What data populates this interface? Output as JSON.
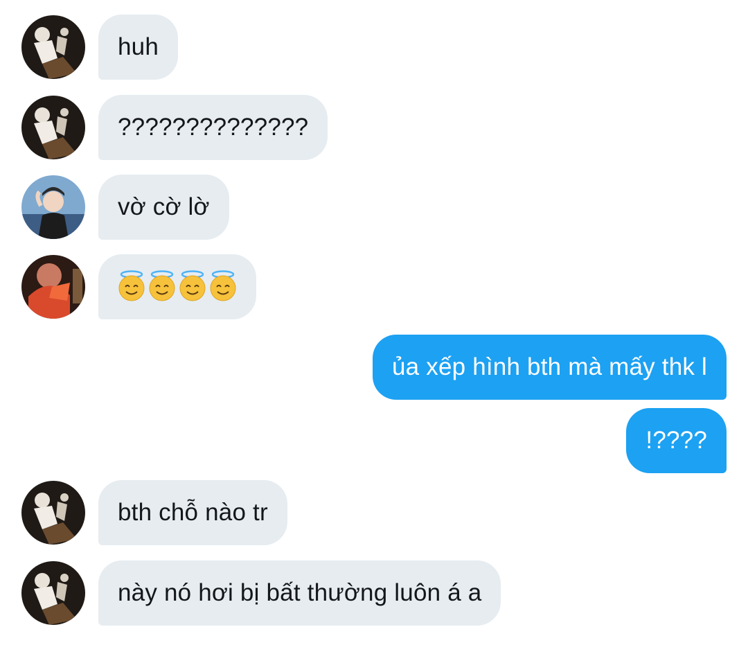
{
  "conversation": {
    "messages": [
      {
        "sender": "friend-1",
        "direction": "incoming",
        "text": "huh"
      },
      {
        "sender": "friend-1",
        "direction": "incoming",
        "text": "??????????????"
      },
      {
        "sender": "friend-2",
        "direction": "incoming",
        "text": "vờ cờ lờ"
      },
      {
        "sender": "friend-3",
        "direction": "incoming",
        "text": "",
        "emoji": [
          "smiling-face-with-halo-icon",
          "smiling-face-with-halo-icon",
          "smiling-face-with-halo-icon",
          "smiling-face-with-halo-icon"
        ]
      },
      {
        "sender": "me",
        "direction": "outgoing",
        "text": "ủa xếp hình bth mà mấy thk l"
      },
      {
        "sender": "me",
        "direction": "outgoing",
        "text": "!????"
      },
      {
        "sender": "friend-1",
        "direction": "incoming",
        "text": "bth chỗ nào tr"
      },
      {
        "sender": "friend-1",
        "direction": "incoming",
        "text": "này nó hơi bị bất thường luôn á a"
      }
    ]
  },
  "colors": {
    "incoming_bubble": "#e6ecf0",
    "incoming_text": "#14171a",
    "outgoing_bubble": "#1da1f2",
    "outgoing_text": "#ffffff"
  }
}
